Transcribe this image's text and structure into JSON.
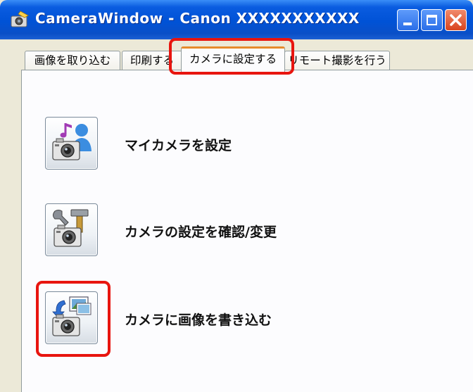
{
  "window": {
    "title": "CameraWindow - Canon XXXXXXXXXXX"
  },
  "tabs": [
    {
      "label": "画像を取り込む",
      "selected": false
    },
    {
      "label": "印刷する",
      "selected": false
    },
    {
      "label": "カメラに設定する",
      "selected": true
    },
    {
      "label": "リモート撮影を行う",
      "selected": false
    }
  ],
  "actions": [
    {
      "label": "マイカメラを設定",
      "icon": "my-camera-icon"
    },
    {
      "label": "カメラの設定を確認/変更",
      "icon": "camera-settings-icon"
    },
    {
      "label": "カメラに画像を書き込む",
      "icon": "write-images-icon"
    }
  ],
  "colors": {
    "highlight": "#e8150f",
    "titlebar": "#0052d6",
    "close_button": "#d9441e"
  }
}
